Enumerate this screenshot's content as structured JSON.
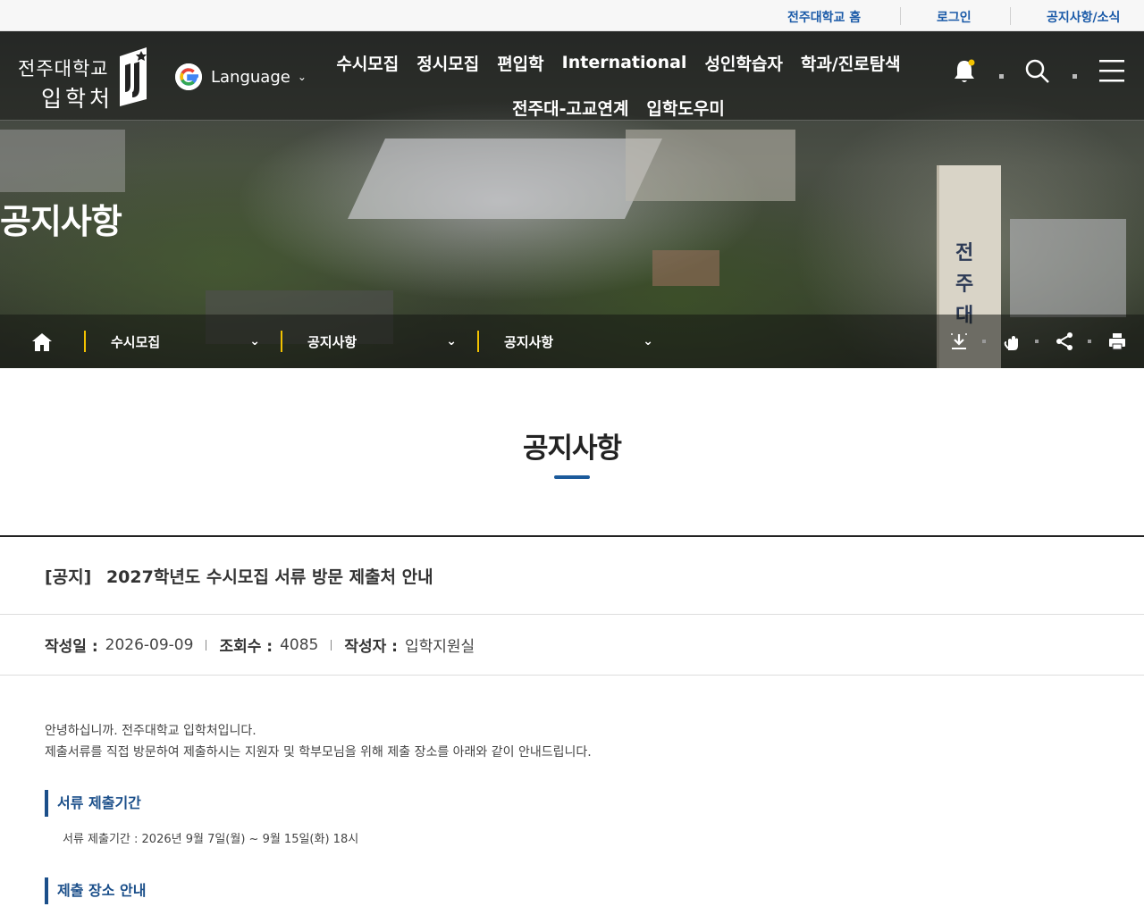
{
  "utility": {
    "links": [
      "전주대학교 홈",
      "로그인",
      "공지사항/소식"
    ]
  },
  "header": {
    "logo": {
      "line1": "전주대학교",
      "line2": "입학처"
    },
    "language_label": "Language",
    "nav_row1": [
      "수시모집",
      "정시모집",
      "편입학",
      "International",
      "성인학습자",
      "학과/진로탐색"
    ],
    "nav_row2": [
      "전주대-고교연계",
      "입학도우미"
    ],
    "icons": [
      "bell-icon",
      "search-icon",
      "menu-icon"
    ]
  },
  "hero": {
    "title": "공지사항",
    "breadcrumb": [
      "수시모집",
      "공지사항",
      "공지사항"
    ],
    "tools": [
      "download-icon",
      "touch-icon",
      "share-icon",
      "print-icon"
    ]
  },
  "page": {
    "heading": "공지사항"
  },
  "post": {
    "prefix": "[공지]",
    "title": "2027학년도 수시모집 서류 방문 제출처 안내",
    "meta": {
      "date_label": "작성일 :",
      "date": "2026-09-09",
      "views_label": "조회수 :",
      "views": "4085",
      "author_label": "작성자 :",
      "author": "입학지원실"
    },
    "intro_1": "안녕하십니까. 전주대학교 입학처입니다.",
    "intro_2": "제출서류를 직접 방문하여 제출하시는 지원자 및 학부모님을 위해 제출 장소를 아래와 같이 안내드립니다.",
    "section1_title": "서류 제출기간",
    "section1_text": "서류 제출기간 : 2026년 9월 7일(월) ~ 9월 15일(화) 18시",
    "section2_title": "제출 장소 안내"
  },
  "colors": {
    "accent": "#1b5a9b",
    "breadcrumb_bar": "#f2c200",
    "link": "#1a5aa8"
  }
}
